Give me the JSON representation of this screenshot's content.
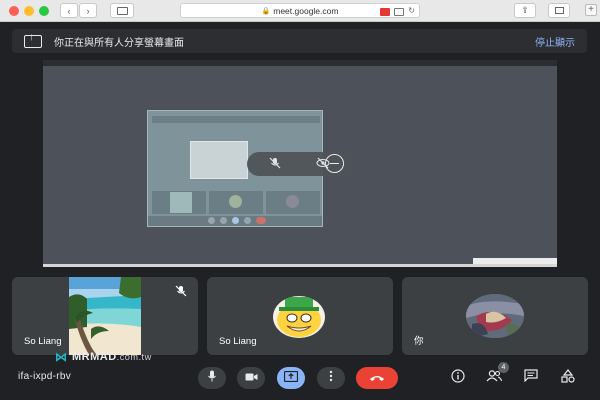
{
  "browser": {
    "url": "meet.google.com",
    "back_icon": "chevron-left-icon",
    "forward_icon": "chevron-right-icon",
    "sidebar_icon": "sidebar-icon"
  },
  "banner": {
    "text": "你正在與所有人分享螢幕畫面",
    "stop_label": "停止顯示"
  },
  "participants": [
    {
      "name": "So Liang",
      "mic_muted": true,
      "media": "beach-photo"
    },
    {
      "name": "So Liang",
      "mic_muted": false,
      "media": "avatar-cartoon"
    },
    {
      "name": "你",
      "mic_muted": false,
      "media": "avatar-photo"
    }
  ],
  "watermark": {
    "brand": "MRMAD",
    "domain": ".com.tw"
  },
  "bottom_bar": {
    "meeting_code": "ifa-ixpd-rbv",
    "people_count": "4"
  },
  "colors": {
    "accent": "#8ab4f8",
    "hangup": "#ea4335",
    "background": "#202124",
    "tile": "#3c4043"
  }
}
